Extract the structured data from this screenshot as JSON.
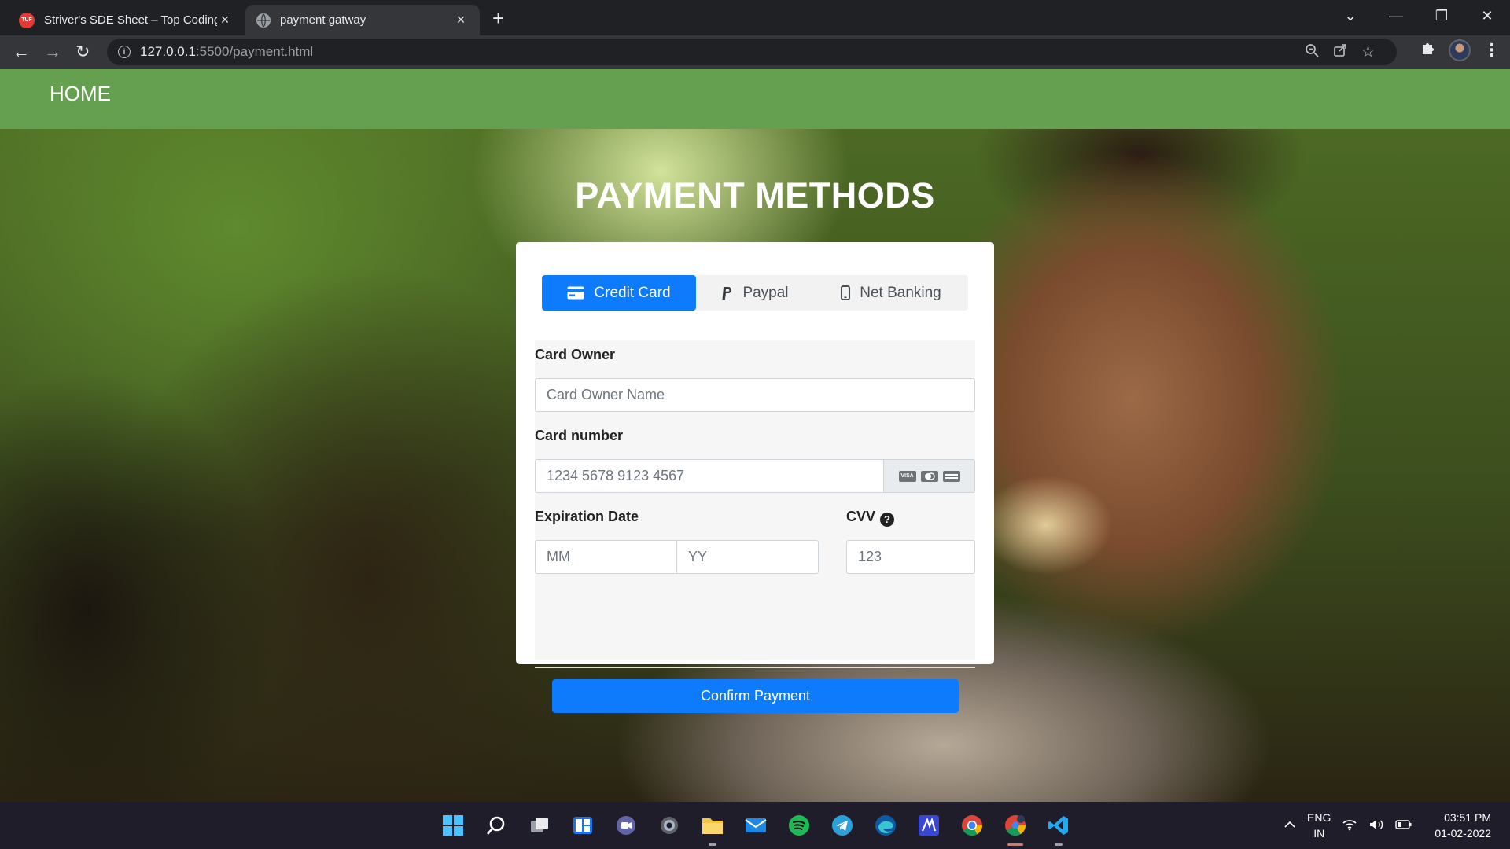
{
  "browser": {
    "tabs": [
      {
        "title": "Striver's SDE Sheet – Top Coding",
        "favicon": "TUF",
        "active": false
      },
      {
        "title": "payment gatway",
        "favicon": "globe-icon",
        "active": true
      }
    ],
    "url_host": "127.0.0.1",
    "url_path": ":5500/payment.html"
  },
  "nav": {
    "home": "HOME",
    "color": "#64a04f"
  },
  "page": {
    "heading": "PAYMENT METHODS",
    "tabs": [
      {
        "label": "Credit Card",
        "icon": "credit-card-icon",
        "active": true
      },
      {
        "label": "Paypal",
        "icon": "paypal-icon",
        "active": false
      },
      {
        "label": "Net Banking",
        "icon": "mobile-icon",
        "active": false
      }
    ],
    "form": {
      "card_owner_label": "Card Owner",
      "card_owner_placeholder": "Card Owner Name",
      "card_number_label": "Card number",
      "card_number_placeholder": "1234 5678 9123 4567",
      "card_icons": [
        "VISA",
        "MC",
        "AMEX"
      ],
      "expiration_label": "Expiration Date",
      "mm_placeholder": "MM",
      "yy_placeholder": "YY",
      "cvv_label": "CVV",
      "cvv_placeholder": "123",
      "confirm_label": "Confirm Payment"
    },
    "accent": "#0d7bfc"
  },
  "taskbar": {
    "language": [
      "ENG",
      "IN"
    ],
    "time": "03:51 PM",
    "date": "01-02-2022"
  }
}
